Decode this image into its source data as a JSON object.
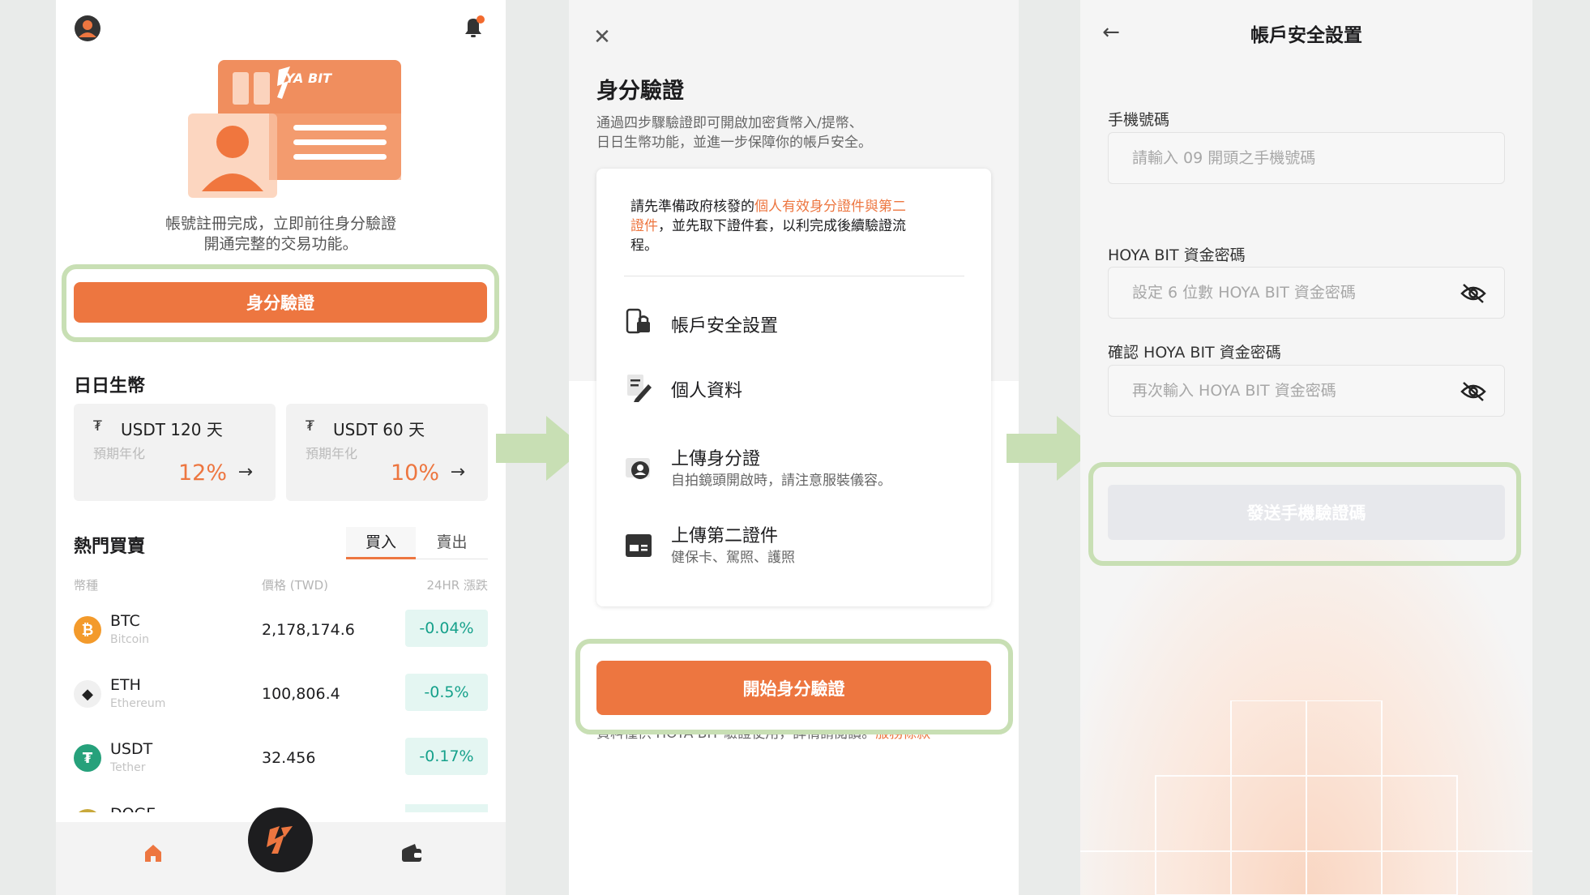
{
  "colors": {
    "accent": "#ed7640",
    "highlight": "#c8dfb4",
    "up_green": "#16a18b"
  },
  "screen1": {
    "card_logo_text": "YA BIT",
    "promo_line1": "帳號註冊完成，立即前往身分驗證",
    "promo_line2": "開通完整的交易功能。",
    "verify_button": "身分驗證",
    "earn_title": "日日生幣",
    "earn_cards": [
      {
        "name": "USDT 120 天",
        "sub": "預期年化",
        "rate": "12%"
      },
      {
        "name": "USDT 60 天",
        "sub": "預期年化",
        "rate": "10%"
      }
    ],
    "hot_title": "熱門買賣",
    "tab_buy": "買入",
    "tab_sell": "賣出",
    "col_coin": "幣種",
    "col_price": "價格 (TWD)",
    "col_change": "24HR 漲跌",
    "coins": [
      {
        "symbol": "BTC",
        "name": "Bitcoin",
        "price": "2,178,174.6",
        "change": "-0.04%",
        "logo": "₿"
      },
      {
        "symbol": "ETH",
        "name": "Ethereum",
        "price": "100,806.4",
        "change": "-0.5%",
        "logo": "◆"
      },
      {
        "symbol": "USDT",
        "name": "Tether",
        "price": "32.456",
        "change": "-0.17%",
        "logo": "₮"
      },
      {
        "symbol": "DOGE",
        "name": "",
        "price": "",
        "change": "",
        "logo": ""
      }
    ]
  },
  "screen2": {
    "title": "身分驗證",
    "intro_line1": "通過四步驟驗證即可開啟加密貨幣入/提幣、",
    "intro_line2": "日日生幣功能，並進一步保障你的帳戶安全。",
    "notice_prefix": "請先準備政府核發的",
    "notice_highlight_1": "個人有效身分證件與第二",
    "notice_highlight_2": "證件",
    "notice_suffix_1": "，並先取下證件套，以利完成後續驗證流",
    "notice_suffix_2": "程。",
    "steps": [
      {
        "title": "帳戶安全設置",
        "sub": ""
      },
      {
        "title": "個人資料",
        "sub": ""
      },
      {
        "title": "上傳身分證",
        "sub": "自拍鏡頭開啟時，請注意服裝儀容。"
      },
      {
        "title": "上傳第二證件",
        "sub": "健保卡、駕照、護照"
      }
    ],
    "start_button": "開始身分驗證",
    "footer_text": "資料僅供 HOYA BIT 驗證使用，詳情請閱讀。",
    "footer_link": "服務條款"
  },
  "screen3": {
    "title": "帳戶安全設置",
    "phone_label": "手機號碼",
    "phone_placeholder": "請輸入 09 開頭之手機號碼",
    "pwd_label": "HOYA BIT 資金密碼",
    "pwd_placeholder": "設定 6 位數 HOYA BIT 資金密碼",
    "confirm_label": "確認 HOYA BIT 資金密碼",
    "confirm_placeholder": "再次輸入 HOYA BIT 資金密碼",
    "send_button": "發送手機驗證碼"
  }
}
